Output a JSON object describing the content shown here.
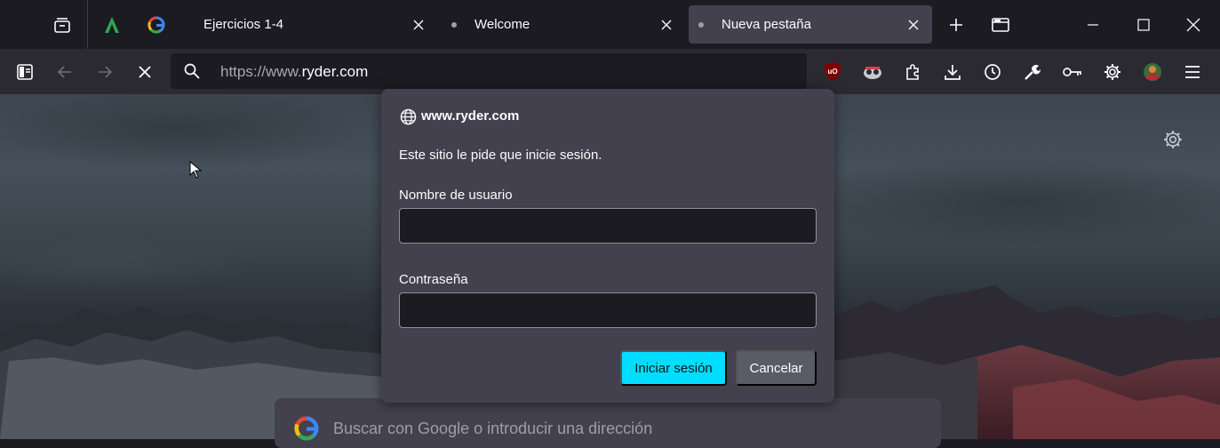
{
  "tabs": [
    {
      "title": "Ejercicios 1-4",
      "close_icon": "close-icon"
    },
    {
      "title": "Welcome",
      "close_icon": "close-icon"
    },
    {
      "title": "Nueva pestaña",
      "close_icon": "close-icon",
      "selected": true
    }
  ],
  "toolbar": {
    "url_prefix": "https://www.",
    "url_domain": "ryder.com"
  },
  "dialog": {
    "host": "www.ryder.com",
    "message": "Este sitio le pide que inicie sesión.",
    "username_label": "Nombre de usuario",
    "username_value": "",
    "password_label": "Contraseña",
    "password_value": "",
    "login_button": "Iniciar sesión",
    "cancel_button": "Cancelar"
  },
  "newtab": {
    "search_placeholder": "Buscar con Google o introducir una dirección"
  },
  "colors": {
    "accent": "#00ddff",
    "toolbar_bg": "#2b2a33",
    "tabbar_bg": "#1c1b22",
    "dialog_bg": "#42414d"
  }
}
